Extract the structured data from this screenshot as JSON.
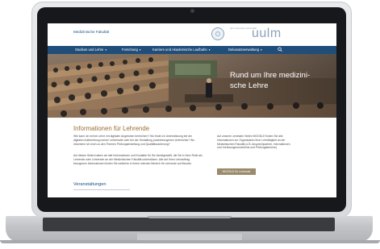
{
  "site": {
    "faculty_link": "Medizinische Fakultät",
    "university_small": "ulm university universität",
    "university_name": "uulm"
  },
  "nav": {
    "items": [
      "Studium und Lehre",
      "Forschung",
      "Karriere und Akademische Laufbahn",
      "Dekanatsverwaltung"
    ],
    "search_icon": "search-icon"
  },
  "hero": {
    "title_line1": "Rund um Ihre medizini-",
    "title_line2": "sche Lehre"
  },
  "content": {
    "heading": "Informationen für Lehrende",
    "paragraph1": "Wie kann ich meine Lehre mit digitalen Angeboten bereichern? Wo finde ich Unterstützung bei der digitalen Aufbereitung meiner Lehrinhalte oder bei der Gestaltung praxisbezogenen Unterrichts? Wo informiere ich mich zu den Themen Prüfungserstellung und Qualitätssicherung?",
    "paragraph2": "Auf diesen Seiten haben wir alle Informationen und Kontakte für Sie bereitgestellt, die Sie in Ihrer Rolle als Lehrende oder Lehrender an der Medizinischen Fakultät unterstützen. Alle auf Ihren Lehrauftrag bezogenen Informationen finden Sie weiterhin in Ihrem internen Bereich für Lehrende auf Moodle.",
    "side_text": "Auf unseren zentralen Seiten MOODLE finden Sie alle Informationen zur Organisation Ihrer Lehrtätigkeit an der Medizinischen Fakultät (z.B. Ansprechpartner, Informationen und Vorlesungsverzeichnis und Prüfungstermine).",
    "moodle_button": "MOODLE für Lehrende",
    "events_heading": "Veranstaltungen"
  },
  "colors": {
    "nav_bg": "#1f4e7a",
    "heading_accent": "#9a6d33",
    "button_bg": "#9b8a6b"
  }
}
